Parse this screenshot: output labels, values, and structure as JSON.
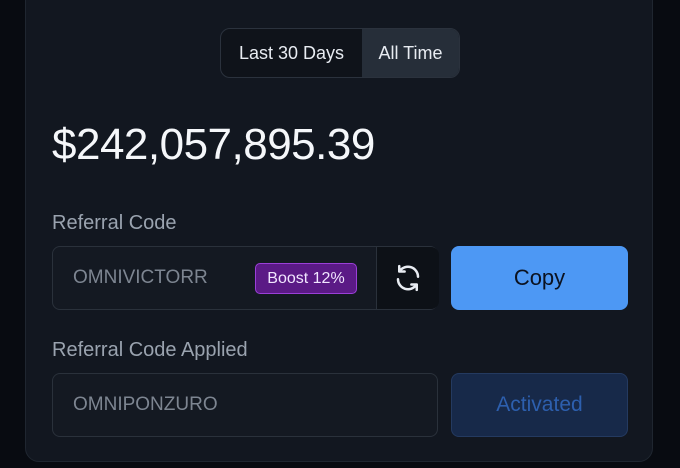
{
  "period_toggle": {
    "options": [
      "Last 30 Days",
      "All Time"
    ],
    "selected": "All Time"
  },
  "total_amount": "$242,057,895.39",
  "referral": {
    "label": "Referral Code",
    "code": "OMNIVICTORR",
    "boost_badge": "Boost 12%",
    "refresh_icon": "refresh-icon",
    "copy_label": "Copy"
  },
  "applied": {
    "label": "Referral Code Applied",
    "code": "OMNIPONZURO",
    "status_label": "Activated"
  },
  "colors": {
    "primary": "#4d98f4",
    "boost_bg": "#5b1a86",
    "boost_border": "#9b3fd8",
    "activated_bg": "#172949",
    "activated_text": "#2d5fae"
  }
}
